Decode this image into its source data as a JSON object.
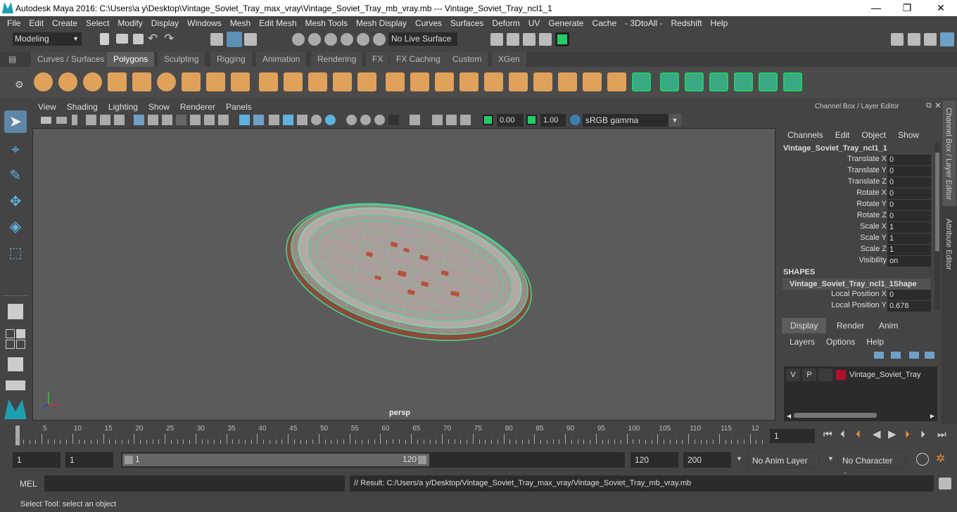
{
  "window": {
    "title": "Autodesk Maya 2016: C:\\Users\\a y\\Desktop\\Vintage_Soviet_Tray_max_vray\\Vintage_Soviet_Tray_mb_vray.mb   ---   Vintage_Soviet_Tray_ncl1_1",
    "min": "—",
    "max": "❐",
    "close": "✕"
  },
  "menubar": [
    "File",
    "Edit",
    "Create",
    "Select",
    "Modify",
    "Display",
    "Windows",
    "Mesh",
    "Edit Mesh",
    "Mesh Tools",
    "Mesh Display",
    "Curves",
    "Surfaces",
    "Deform",
    "UV",
    "Generate",
    "Cache",
    "- 3DtoAll -",
    "Redshift",
    "Help"
  ],
  "status": {
    "mode": "Modeling",
    "live_surface": "No Live Surface"
  },
  "shelf_tabs": [
    "Curves / Surfaces",
    "Polygons",
    "Sculpting",
    "Rigging",
    "Animation",
    "Rendering",
    "FX",
    "FX Caching",
    "Custom",
    "XGen"
  ],
  "shelf_active": "Polygons",
  "viewport": {
    "menu": [
      "View",
      "Shading",
      "Lighting",
      "Show",
      "Renderer",
      "Panels"
    ],
    "exposure": "0.00",
    "gamma": "1.00",
    "color_space": "sRGB gamma",
    "camera": "persp"
  },
  "channel_box": {
    "header": "Channel Box / Layer Editor",
    "menu": [
      "Channels",
      "Edit",
      "Object",
      "Show"
    ],
    "object": "Vintage_Soviet_Tray_ncl1_1",
    "channels": [
      {
        "label": "Translate X",
        "value": "0"
      },
      {
        "label": "Translate Y",
        "value": "0"
      },
      {
        "label": "Translate Z",
        "value": "0"
      },
      {
        "label": "Rotate X",
        "value": "0"
      },
      {
        "label": "Rotate Y",
        "value": "0"
      },
      {
        "label": "Rotate Z",
        "value": "0"
      },
      {
        "label": "Scale X",
        "value": "1"
      },
      {
        "label": "Scale Y",
        "value": "1"
      },
      {
        "label": "Scale Z",
        "value": "1"
      },
      {
        "label": "Visibility",
        "value": "on"
      }
    ],
    "shapes_label": "SHAPES",
    "shape_name": "Vintage_Soviet_Tray_ncl1_1Shape",
    "shape_channels": [
      {
        "label": "Local Position X",
        "value": "0"
      },
      {
        "label": "Local Position Y",
        "value": "0.678"
      }
    ]
  },
  "layer_editor": {
    "tabs": [
      "Display",
      "Render",
      "Anim"
    ],
    "menu": [
      "Layers",
      "Options",
      "Help"
    ],
    "layer": {
      "v": "V",
      "p": "P",
      "name": "Vintage_Soviet_Tray",
      "color": "#b0102a"
    }
  },
  "side_tabs": [
    "Channel Box / Layer Editor",
    "Attribute Editor"
  ],
  "timeline": {
    "ticks": [
      "5",
      "10",
      "15",
      "20",
      "25",
      "30",
      "35",
      "40",
      "45",
      "50",
      "55",
      "60",
      "65",
      "70",
      "75",
      "80",
      "85",
      "90",
      "95",
      "100",
      "105",
      "110",
      "115",
      "12"
    ],
    "start_tick": "1",
    "current_frame": "1"
  },
  "range": {
    "start": "1",
    "inner_start": "1",
    "slider_start": "1",
    "slider_end": "120",
    "end": "120",
    "outer_end": "200",
    "anim_layer": "No Anim Layer",
    "char_set": "No Character Set"
  },
  "cmd": {
    "label": "MEL",
    "result": "// Result: C:/Users/a y/Desktop/Vintage_Soviet_Tray_max_vray/Vintage_Soviet_Tray_mb_vray.mb"
  },
  "help_line": "Select Tool: select an object"
}
